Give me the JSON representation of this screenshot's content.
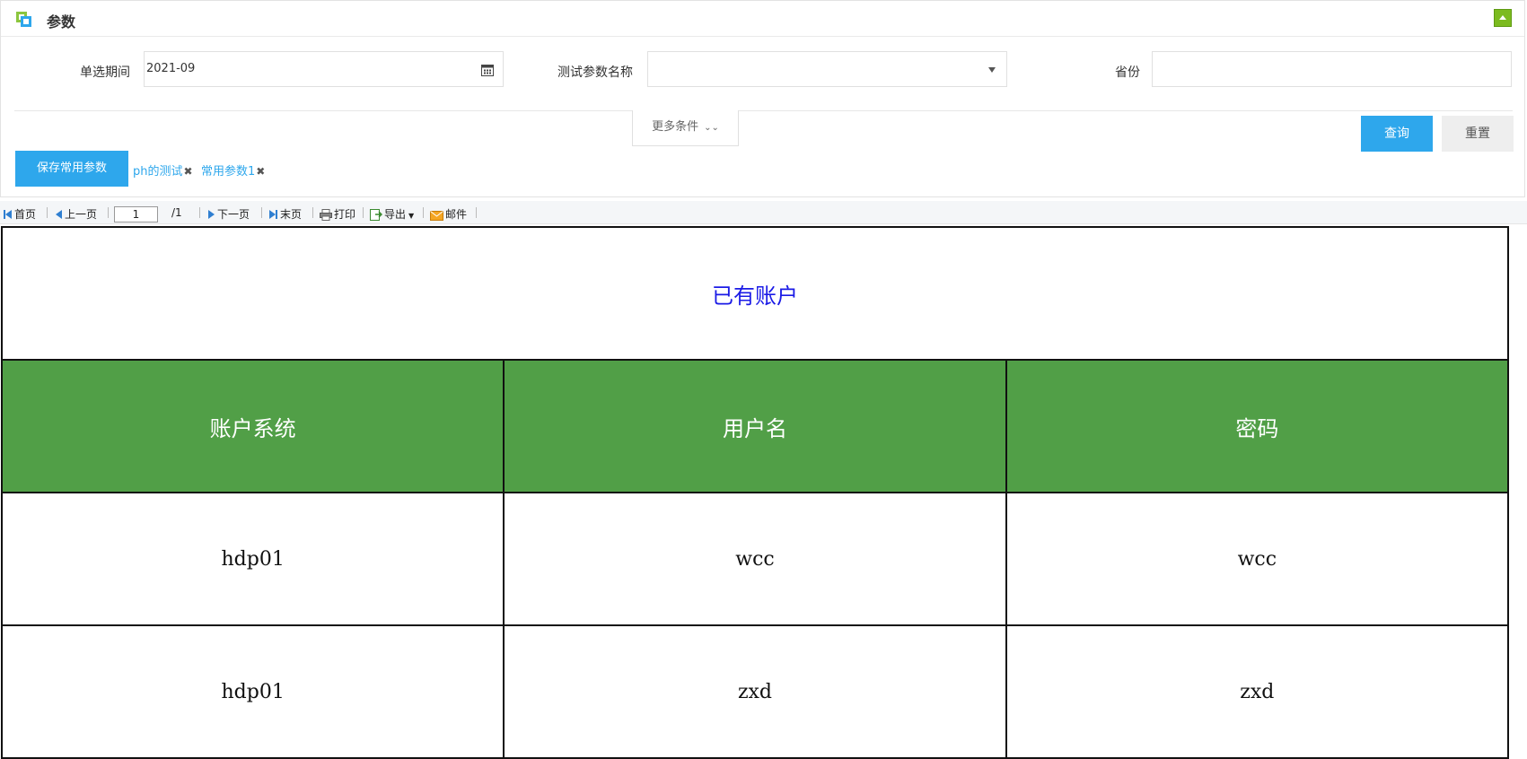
{
  "panel": {
    "title": "参数",
    "icon": "layers-icon",
    "collapse_icon": "collapse-up-icon",
    "collapse_color": "#7cbb1f"
  },
  "filters": {
    "period": {
      "label": "单选期间",
      "value": "2021-09",
      "icon": "calendar-icon"
    },
    "param_name": {
      "label": "测试参数名称",
      "value": ""
    },
    "province": {
      "label": "省份",
      "value": ""
    },
    "more_label": "更多条件"
  },
  "actions": {
    "query_label": "查询",
    "reset_label": "重置",
    "save_label": "保存常用参数",
    "accent_color": "#2ea7ec"
  },
  "saved_params": [
    "ph的测试",
    "常用参数1"
  ],
  "toolbar": {
    "first_label": "首页",
    "prev_label": "上一页",
    "page_value": "1",
    "total_pages": "/1",
    "next_label": "下一页",
    "last_label": "末页",
    "print_label": "打印",
    "export_label": "导出",
    "mail_label": "邮件"
  },
  "report": {
    "title": "已有账户",
    "title_color": "#1a1ae6",
    "header_color": "#519f47",
    "columns": [
      "账户系统",
      "用户名",
      "密码"
    ],
    "rows": [
      [
        "hdp01",
        "wcc",
        "wcc"
      ],
      [
        "hdp01",
        "zxd",
        "zxd"
      ]
    ]
  }
}
